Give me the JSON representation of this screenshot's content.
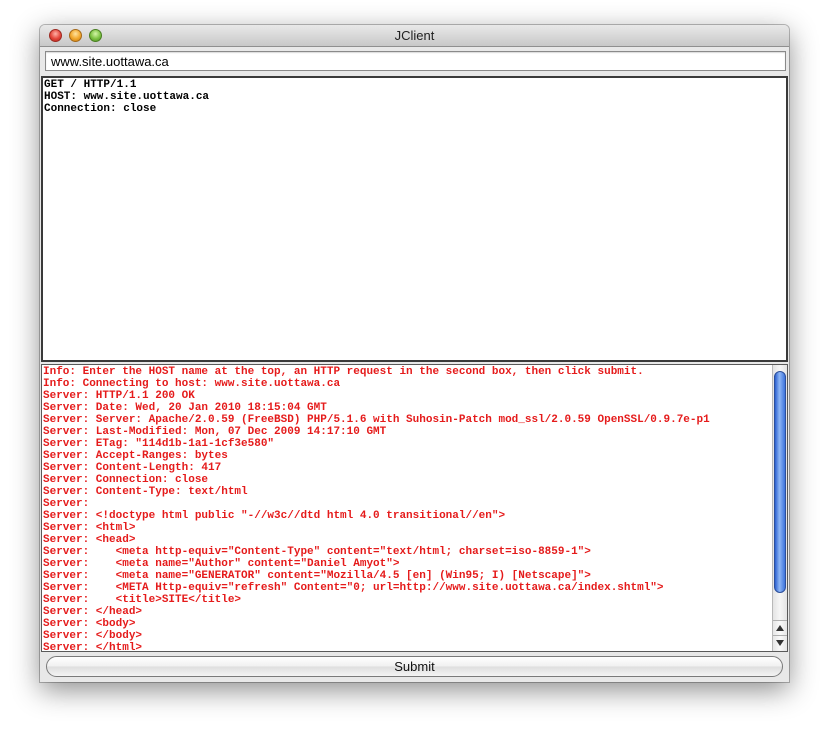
{
  "window": {
    "title": "JClient"
  },
  "host": {
    "value": "www.site.uottawa.ca"
  },
  "request": {
    "text": "GET / HTTP/1.1\nHOST: www.site.uottawa.ca\nConnection: close"
  },
  "response": {
    "text_color": "#e51b1b",
    "lines": [
      "Info: Enter the HOST name at the top, an HTTP request in the second box, then click submit.",
      "Info: Connecting to host: www.site.uottawa.ca",
      "Server: HTTP/1.1 200 OK",
      "Server: Date: Wed, 20 Jan 2010 18:15:04 GMT",
      "Server: Server: Apache/2.0.59 (FreeBSD) PHP/5.1.6 with Suhosin-Patch mod_ssl/2.0.59 OpenSSL/0.9.7e-p1",
      "Server: Last-Modified: Mon, 07 Dec 2009 14:17:10 GMT",
      "Server: ETag: \"114d1b-1a1-1cf3e580\"",
      "Server: Accept-Ranges: bytes",
      "Server: Content-Length: 417",
      "Server: Connection: close",
      "Server: Content-Type: text/html",
      "Server:",
      "Server: <!doctype html public \"-//w3c//dtd html 4.0 transitional//en\">",
      "Server: <html>",
      "Server: <head>",
      "Server:    <meta http-equiv=\"Content-Type\" content=\"text/html; charset=iso-8859-1\">",
      "Server:    <meta name=\"Author\" content=\"Daniel Amyot\">",
      "Server:    <meta name=\"GENERATOR\" content=\"Mozilla/4.5 [en] (Win95; I) [Netscape]\">",
      "Server:    <META Http-equiv=\"refresh\" Content=\"0; url=http://www.site.uottawa.ca/index.shtml\">",
      "Server:    <title>SITE</title>",
      "Server: </head>",
      "Server: <body>",
      "Server: </body>",
      "Server: </html>"
    ]
  },
  "submit": {
    "label": "Submit"
  },
  "icons": {
    "close": "close-traffic-light-icon",
    "minimize": "minimize-traffic-light-icon",
    "zoom": "zoom-traffic-light-icon",
    "scroll_up": "arrow-up-icon",
    "scroll_down": "arrow-down-icon"
  },
  "colors": {
    "accent_scroll": "#3d73dc",
    "close": "#e4453a",
    "minimize": "#f2a72c",
    "zoom": "#7cc242"
  }
}
